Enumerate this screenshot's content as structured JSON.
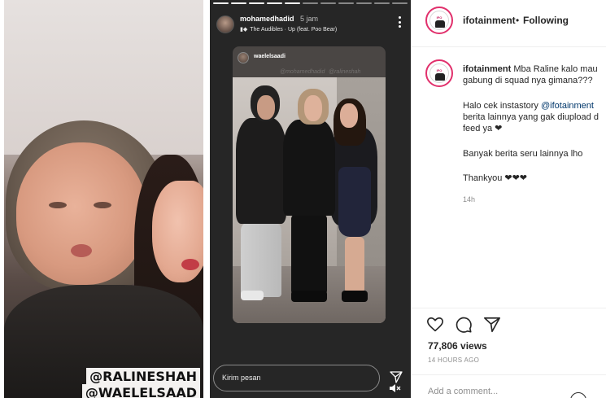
{
  "left_story": {
    "tags": [
      "@RALINESHAH",
      "@WAELELSAAD"
    ]
  },
  "story": {
    "username": "mohamedhadid",
    "time": "5 jam",
    "music": "The Audibles · Up (feat. Poo Bear)",
    "music_icon": "music-bars-icon",
    "inner_card": {
      "username": "waelelsaadi",
      "watermarks": [
        "@mohamedhadid",
        "@ralineshah"
      ]
    },
    "reply_placeholder": "Kirim pesan",
    "send_icon": "paper-plane-icon",
    "mute_icon": "speaker-muted-icon"
  },
  "post": {
    "header": {
      "username": "ifotainment",
      "separator": "•",
      "follow_status": "Following"
    },
    "caption": {
      "username": "ifotainment",
      "line1": "Mba Raline kalo mau",
      "line2": "gabung di squad nya gimana???",
      "line3_prefix": "Halo cek instastory ",
      "line3_mention": "@ifotainment",
      "line4": "berita lainnya yang gak diupload d",
      "line5": "feed ya ❤",
      "line6": "Banyak berita seru lainnya lho",
      "line7": "Thankyou ❤❤❤"
    },
    "caption_time": "14h",
    "actions": [
      "heart-icon",
      "comment-icon",
      "share-icon"
    ],
    "views": "77,806 views",
    "posted_ago": "14 HOURS AGO",
    "comment_placeholder": "Add a comment...",
    "avatar_brand": "ifotainment",
    "accent_color": "#e1306c",
    "mention_color": "#00376b"
  }
}
